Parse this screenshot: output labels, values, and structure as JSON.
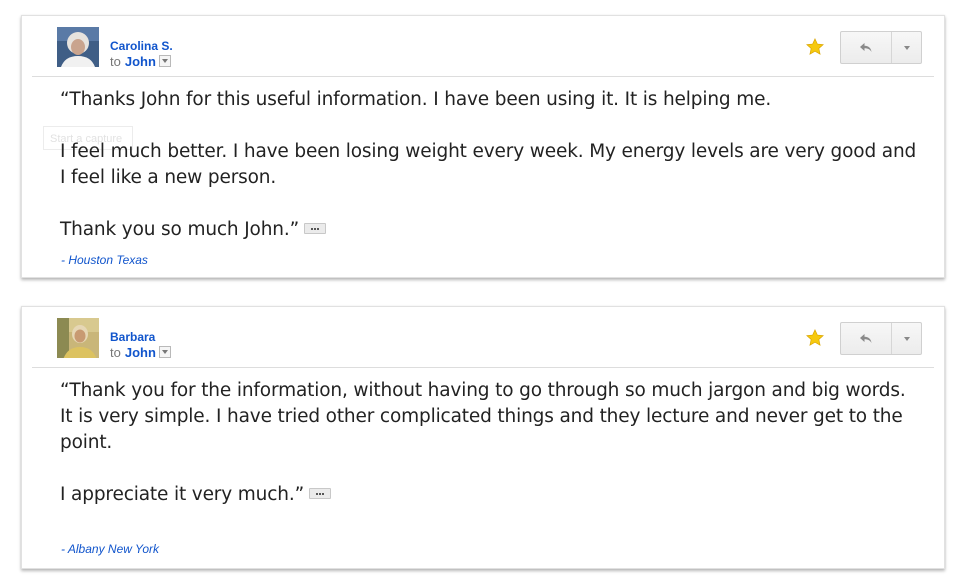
{
  "messages": [
    {
      "sender": "Carolina S.",
      "to_label": "to",
      "recipient": "John",
      "avatar": "person-photo",
      "starred": true,
      "star_color": "#f6c90e",
      "paragraphs": [
        "“Thanks John for this useful information. I have been using it. It is helping me.",
        "I feel much better. I have been losing weight every week. My energy levels are very good and I feel like a new person.",
        "Thank you so much John.”"
      ],
      "location": "- Houston Texas",
      "ghost_text": "Start a capture"
    },
    {
      "sender": "Barbara",
      "to_label": "to",
      "recipient": "John",
      "avatar": "person-photo",
      "starred": true,
      "star_color": "#f6c90e",
      "paragraphs": [
        "“Thank you for the information, without having to go through so much jargon and big words. It is very simple. I have tried other complicated things and they lecture and never get to the point.",
        "I appreciate it very much.”"
      ],
      "location": "- Albany New York"
    }
  ],
  "colors": {
    "link_blue": "#1155cc",
    "body_text": "#222222",
    "muted": "#777777"
  },
  "icons": {
    "reply": "reply-arrow-icon",
    "more": "chevron-down-icon",
    "star": "star-icon",
    "expand": "ellipsis-icon"
  }
}
